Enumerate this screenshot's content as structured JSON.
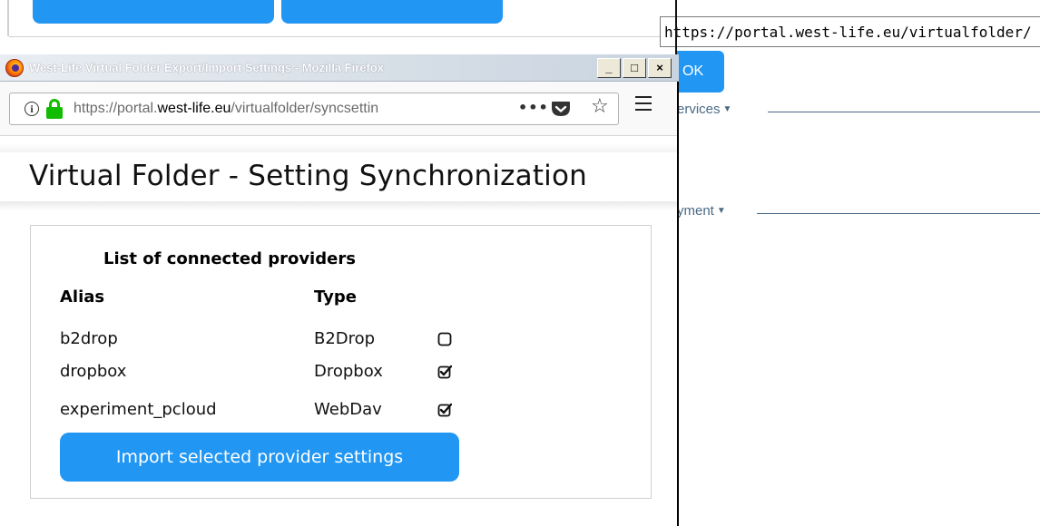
{
  "background": {
    "url_value": "https://portal.west-life.eu/virtualfolder/",
    "ok_label": "OK",
    "sections": [
      {
        "label": "ervices"
      },
      {
        "label": "yment"
      }
    ]
  },
  "window": {
    "title": "West-Life Virtual Folder Export/Import Settings - Mozilla Firefox",
    "controls": {
      "minimize": "_",
      "maximize": "□",
      "close": "×"
    }
  },
  "navbar": {
    "url_prefix": "https://portal.",
    "url_host": "west-life.eu",
    "url_path": "/virtualfolder/syncsettin",
    "more_label": "•••"
  },
  "page": {
    "title": "Virtual Folder - Setting Synchronization"
  },
  "providers": {
    "heading": "List of connected providers",
    "columns": {
      "alias": "Alias",
      "type": "Type"
    },
    "rows": [
      {
        "alias": "b2drop",
        "type": "B2Drop",
        "checked": false
      },
      {
        "alias": "dropbox",
        "type": "Dropbox",
        "checked": true
      },
      {
        "alias": "experiment_pcloud",
        "type": "WebDav",
        "checked": true
      }
    ],
    "import_button": "Import selected provider settings"
  },
  "colors": {
    "accent": "#2196f3",
    "lock_green": "#12bc00",
    "section_link": "#4a6a86"
  }
}
